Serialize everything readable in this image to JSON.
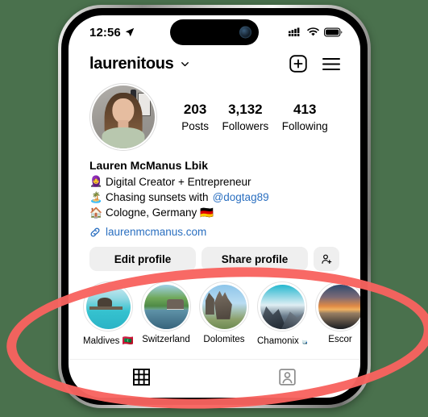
{
  "status_bar": {
    "time": "12:56",
    "location_icon": "location-arrow-icon",
    "signal_icon": "cellular-signal-icon",
    "wifi_icon": "wifi-icon",
    "battery_icon": "battery-icon"
  },
  "header": {
    "username": "laurenitous",
    "chevron_icon": "chevron-down-icon",
    "new_post_icon": "plus-square-icon",
    "menu_icon": "hamburger-menu-icon"
  },
  "profile": {
    "avatar_alt": "profile-photo",
    "stats": [
      {
        "value": "203",
        "label": "Posts"
      },
      {
        "value": "3,132",
        "label": "Followers"
      },
      {
        "value": "413",
        "label": "Following"
      }
    ],
    "display_name": "Lauren McManus Lbik",
    "bio_lines": [
      {
        "emoji": "🧕",
        "text": "Digital Creator + Entrepreneur",
        "mention": ""
      },
      {
        "emoji": "🏝️",
        "text": "Chasing sunsets with ",
        "mention": "@dogtag89"
      },
      {
        "emoji": "🏠",
        "text": "Cologne, Germany 🇩🇪",
        "mention": ""
      }
    ],
    "link_icon": "link-chain-icon",
    "link_text": "laurenmcmanus.com"
  },
  "action_buttons": [
    {
      "label": "Edit profile",
      "name": "edit-profile-button"
    },
    {
      "label": "Share profile",
      "name": "share-profile-button"
    },
    {
      "label": "",
      "name": "add-person-button",
      "icon": "person-add-icon"
    }
  ],
  "highlights": [
    {
      "label": "Maldives 🇲🇻",
      "art": "hi-maldives",
      "name": "highlight-maldives"
    },
    {
      "label": "Switzerland",
      "art": "hi-swiss",
      "name": "highlight-switzerland"
    },
    {
      "label": "Dolomites",
      "art": "hi-dolomites",
      "name": "highlight-dolomites"
    },
    {
      "label": "Chamonix 🎿",
      "art": "hi-chamonix",
      "name": "highlight-chamonix"
    },
    {
      "label": "Escor",
      "art": "hi-escorted",
      "name": "highlight-escorted"
    }
  ],
  "tab_bar": [
    {
      "icon": "grid-posts-icon",
      "name": "tab-posts",
      "active": true
    },
    {
      "icon": "tagged-person-icon",
      "name": "tab-tagged",
      "active": false
    }
  ],
  "annotation": {
    "shape": "ellipse-highlight",
    "color": "#f8635f",
    "target": "highlights-row"
  },
  "colors": {
    "accent_link": "#2a6fc0",
    "button_bg": "#efefef",
    "annotation_red": "#f8635f",
    "background": "#4a714d"
  }
}
